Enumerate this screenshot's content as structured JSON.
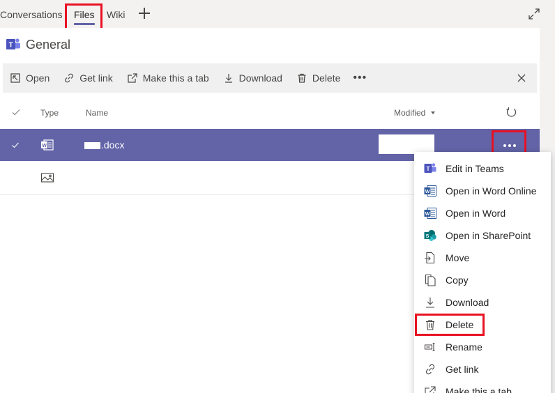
{
  "tabs": [
    {
      "label": "Conversations"
    },
    {
      "label": "Files"
    },
    {
      "label": "Wiki"
    }
  ],
  "channel": {
    "name": "General"
  },
  "toolbar": {
    "open": "Open",
    "get_link": "Get link",
    "make_tab": "Make this a tab",
    "download": "Download",
    "delete": "Delete",
    "more": "•••"
  },
  "table": {
    "headers": {
      "type": "Type",
      "name": "Name",
      "modified": "Modified"
    },
    "rows": [
      {
        "name": ".docx",
        "type_icon": "word-file-icon",
        "selected": true
      },
      {
        "name": "",
        "type_icon": "image-file-icon",
        "selected": false
      }
    ]
  },
  "context_menu": {
    "items": [
      {
        "label": "Edit in Teams",
        "icon": "teams-icon"
      },
      {
        "label": "Open in Word Online",
        "icon": "word-icon"
      },
      {
        "label": "Open in Word",
        "icon": "word-icon"
      },
      {
        "label": "Open in SharePoint",
        "icon": "sharepoint-icon"
      },
      {
        "label": "Move",
        "icon": "move-icon"
      },
      {
        "label": "Copy",
        "icon": "copy-icon"
      },
      {
        "label": "Download",
        "icon": "download-icon"
      },
      {
        "label": "Delete",
        "icon": "trash-icon"
      },
      {
        "label": "Rename",
        "icon": "rename-icon"
      },
      {
        "label": "Get link",
        "icon": "link-icon"
      },
      {
        "label": "Make this a tab",
        "icon": "make-tab-icon"
      }
    ]
  },
  "colors": {
    "accent": "#6264a7",
    "highlight": "#e81123"
  }
}
